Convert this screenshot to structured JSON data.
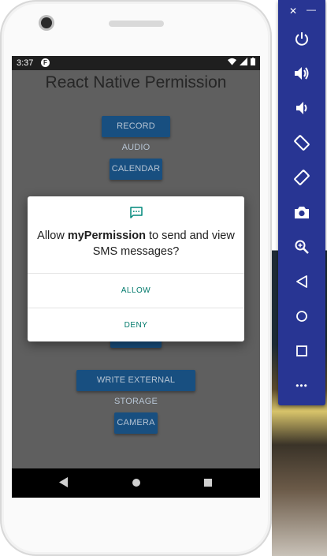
{
  "status_bar": {
    "time": "3:37",
    "notification_badge": "F"
  },
  "app": {
    "title": "React Native Permission",
    "buttons": {
      "record_audio": "RECORD AUDIO",
      "calendar": "CALENDAR",
      "write_external_storage": "WRITE EXTERNAL STORAGE",
      "camera": "CAMERA"
    }
  },
  "dialog": {
    "icon": "sms-message-icon",
    "message_prefix": "Allow ",
    "app_name": "myPermission",
    "message_suffix": " to send and view SMS messages?",
    "allow_label": "ALLOW",
    "deny_label": "DENY"
  },
  "emulator_toolbar": {
    "close_glyph": "✕",
    "minimize_glyph": "—",
    "more_glyph": "•••",
    "tools": [
      "power-icon",
      "volume-up-icon",
      "volume-down-icon",
      "rotate-left-icon",
      "rotate-right-icon",
      "screenshot-icon",
      "zoom-icon",
      "back-icon",
      "home-icon",
      "overview-icon",
      "more-icon"
    ]
  },
  "colors": {
    "accent_teal": "#00796b",
    "button_blue": "#184f80",
    "toolbar_indigo": "#283593"
  }
}
